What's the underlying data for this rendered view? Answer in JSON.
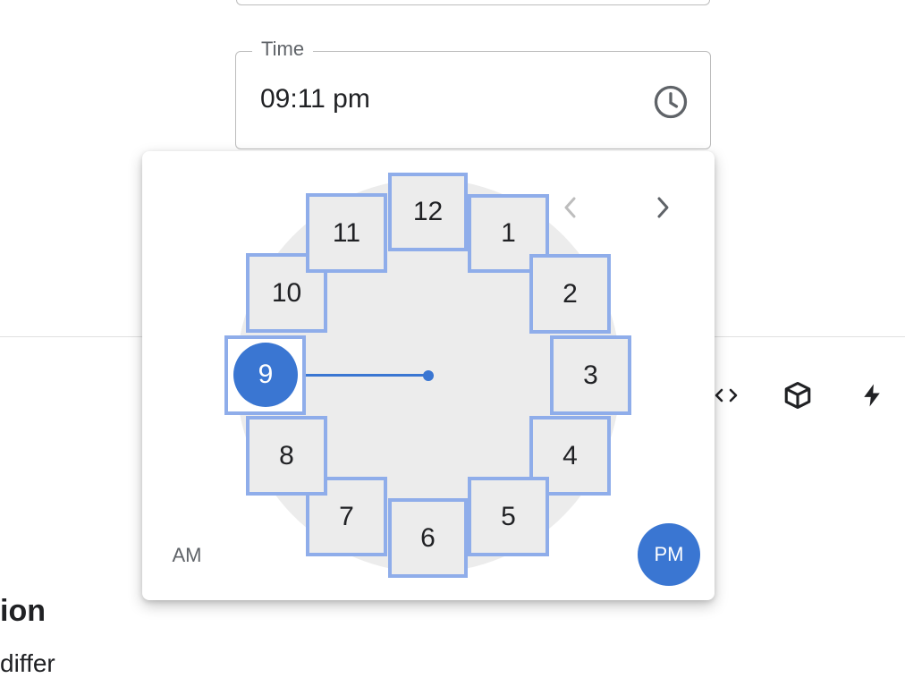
{
  "time_field": {
    "label": "Time",
    "value": "09:11 pm",
    "icon": "clock-icon"
  },
  "page": {
    "section_heading": "ion",
    "body_text": "differ",
    "toolbar_icons": [
      "code-icon",
      "cube-icon",
      "bolt-icon"
    ]
  },
  "clock_picker": {
    "hours": [
      "12",
      "1",
      "2",
      "3",
      "4",
      "5",
      "6",
      "7",
      "8",
      "9",
      "10",
      "11"
    ],
    "selected_hour": "9",
    "am_label": "AM",
    "pm_label": "PM",
    "meridiem": "PM",
    "prev_icon": "chevron-left-icon",
    "next_icon": "chevron-right-icon"
  },
  "colors": {
    "accent": "#3a76d2",
    "dial": "#ececec",
    "hour_outline": "#8fadea",
    "border": "#bdbdbd"
  }
}
